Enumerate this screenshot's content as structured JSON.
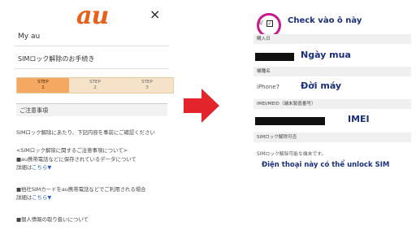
{
  "left": {
    "logo": "au",
    "close_icon": "×",
    "my_au": "My au",
    "sim_unlock_title": "SIMロック解除のお手続き",
    "steps": [
      {
        "label": "STEP",
        "num": "1"
      },
      {
        "label": "STEP",
        "num": "2"
      },
      {
        "label": "STEP",
        "num": "3"
      }
    ],
    "caution_title": "ご注意事項",
    "intro": "SIMロック解除にあたり、下記内容を事前にご確認ください",
    "about": "<SIMロック解除に関するご注意事項について>",
    "item1": "■au携帯電話などに保存されているデータについて",
    "details1_prefix": "詳細は",
    "details1_link": "こちら▼",
    "item2": "■他社SIMカードをau携帯電話などでご利用される場合",
    "details2_prefix": "詳細は",
    "details2_link": "こちら▼",
    "item3": "■個人情報の取り扱いについて"
  },
  "right": {
    "check_text": "Check vào ô này",
    "check_mark": "✓",
    "check_prefix": "I/",
    "purchase_label": "購入日",
    "purchase_note": "Ngày mua",
    "model_label": "機種名",
    "model_value": "iPhone7",
    "model_note": "Đời máy",
    "imei_label": "IMEI/MEID（端末製造番号）",
    "imei_note": "IMEI",
    "sim_possible_label": "SIMロック解除可否",
    "sim_possible_value": "SIMロック解除可能な端末です。",
    "unlock_note": "Điện thoại này có thể unlock SIM"
  },
  "colors": {
    "au_orange": "#e8611c",
    "arrow_red": "#e3242b",
    "annotation_blue": "#1a2f7a",
    "circle_magenta": "#c81a8f",
    "link_blue": "#2b62c0"
  }
}
